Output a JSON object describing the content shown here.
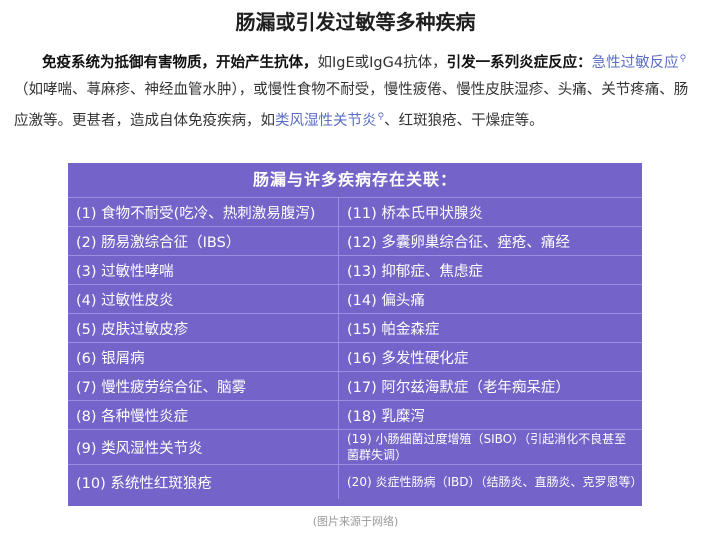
{
  "title": "肠漏或引发过敏等多种疾病",
  "paragraph": {
    "bold1": "免疫系统为抵御有害物质，开始产生抗体，",
    "text1": "如IgE或IgG4抗体，",
    "bold2": "引发一系列炎症反应：",
    "link1": "急性过敏反应",
    "text2": "（如哮喘、荨麻疹、神经血管水肿），或慢性食物不耐受，慢性疲倦、慢性皮肤湿疹、头痛、关节疼痛、肠应激等。更甚者，造成自体免疫疾病，如",
    "link2": "类风湿性关节炎",
    "text3": "、红斑狼疮、干燥症等。"
  },
  "panel": {
    "header": "肠漏与许多疾病存在关联：",
    "rows": [
      {
        "left": "(1) 食物不耐受(吃冷、热刺激易腹泻)",
        "right": "(11) 桥本氏甲状腺炎"
      },
      {
        "left": "(2) 肠易激综合征（IBS）",
        "right": "(12) 多囊卵巢综合征、痤疮、痛经"
      },
      {
        "left": "(3) 过敏性哮喘",
        "right": "(13) 抑郁症、焦虑症"
      },
      {
        "left": "(4) 过敏性皮炎",
        "right": "(14) 偏头痛"
      },
      {
        "left": "(5) 皮肤过敏皮疹",
        "right": "(15) 帕金森症"
      },
      {
        "left": "(6) 银屑病",
        "right": "(16) 多发性硬化症"
      },
      {
        "left": "(7) 慢性疲劳综合征、脑雾",
        "right": "(17) 阿尔兹海默症（老年痴呆症）"
      },
      {
        "left": "(8) 各种慢性炎症",
        "right": "(18) 乳糜泻"
      },
      {
        "left": "(9) 类风湿性关节炎",
        "right": "(19) 小肠细菌过度增殖（SIBO）（引起消化不良甚至菌群失调）"
      },
      {
        "left": "(10) 系统性红斑狼疮",
        "right": "(20) 炎症性肠病（IBD）（结肠炎、直肠炎、克罗恩等）"
      }
    ]
  },
  "caption": "(图片来源于网络)"
}
